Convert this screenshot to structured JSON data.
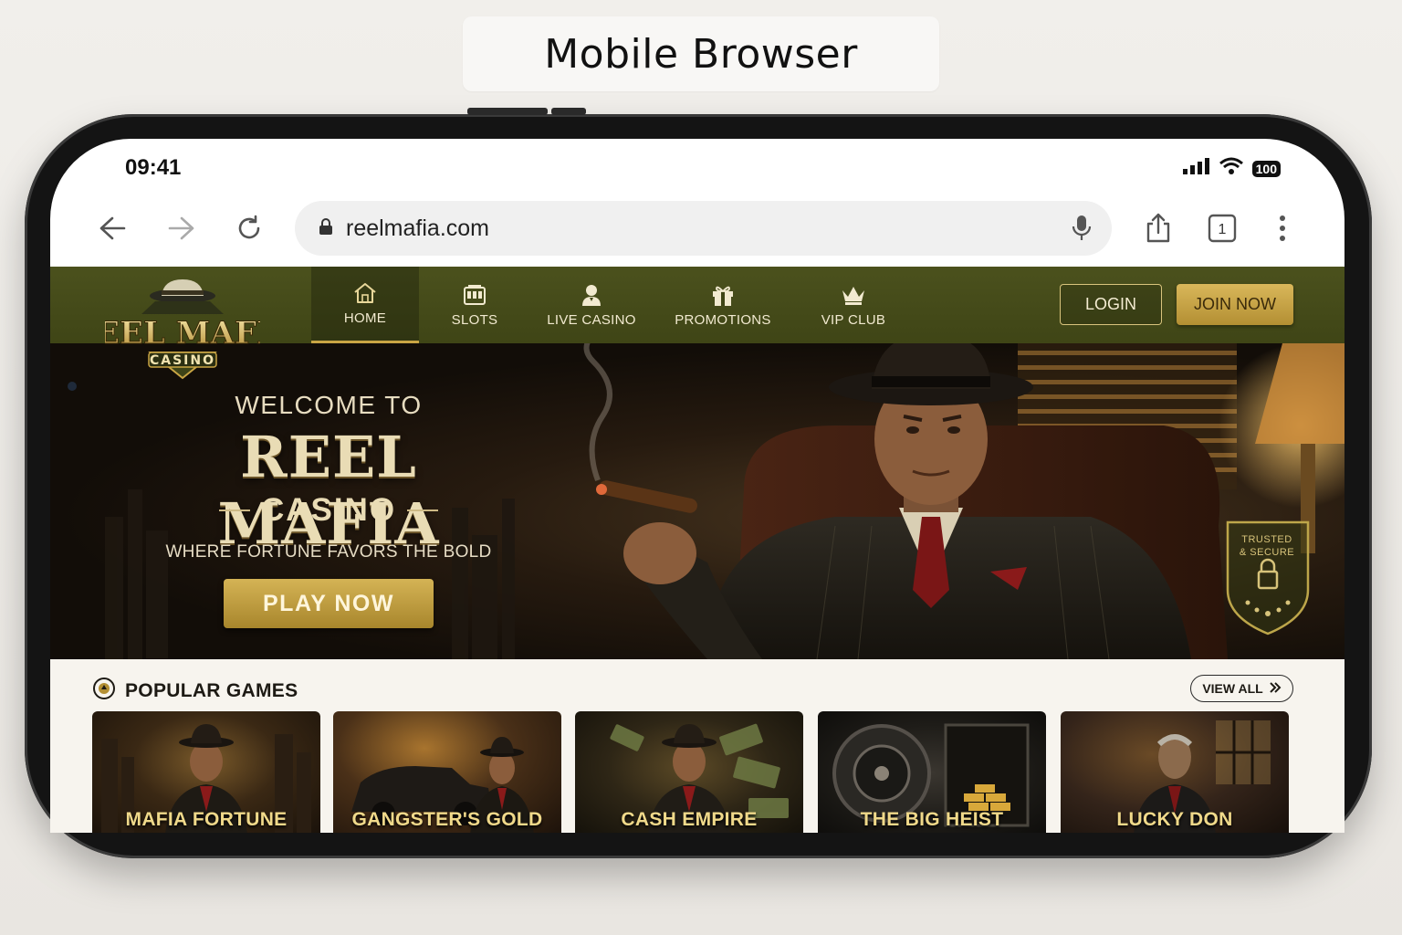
{
  "caption": "Mobile Browser",
  "status_bar": {
    "time": "09:41",
    "battery": "100"
  },
  "browser": {
    "url": "reelmafia.com",
    "tab_count": "1"
  },
  "site": {
    "logo": {
      "line1": "REEL MAFIA",
      "line2": "CASINO"
    },
    "nav": [
      {
        "label": "HOME",
        "icon": "home-icon",
        "active": true
      },
      {
        "label": "SLOTS",
        "icon": "slot-machine-icon"
      },
      {
        "label": "LIVE CASINO",
        "icon": "dealer-icon"
      },
      {
        "label": "PROMOTIONS",
        "icon": "gift-icon"
      },
      {
        "label": "VIP CLUB",
        "icon": "crown-icon"
      }
    ],
    "login_label": "LOGIN",
    "join_label": "JOIN NOW",
    "hero": {
      "welcome": "WELCOME TO",
      "brand": "REEL MAFIA",
      "casino": "CASINO",
      "tagline": "WHERE FORTUNE FAVORS THE BOLD",
      "play_label": "PLAY NOW",
      "badge_line1": "TRUSTED",
      "badge_line2": "& SECURE"
    },
    "popular": {
      "title": "POPULAR GAMES",
      "view_all": "VIEW ALL",
      "games": [
        {
          "title": "MAFIA FORTUNE"
        },
        {
          "title": "GANGSTER'S GOLD"
        },
        {
          "title": "CASH EMPIRE"
        },
        {
          "title": "THE BIG HEIST"
        },
        {
          "title": "LUCKY DON"
        }
      ]
    }
  },
  "colors": {
    "nav_bg": "#4b511d",
    "gold": "#c9a544",
    "hero_bg": "#120d08",
    "games_bg": "#f7f4ee"
  }
}
